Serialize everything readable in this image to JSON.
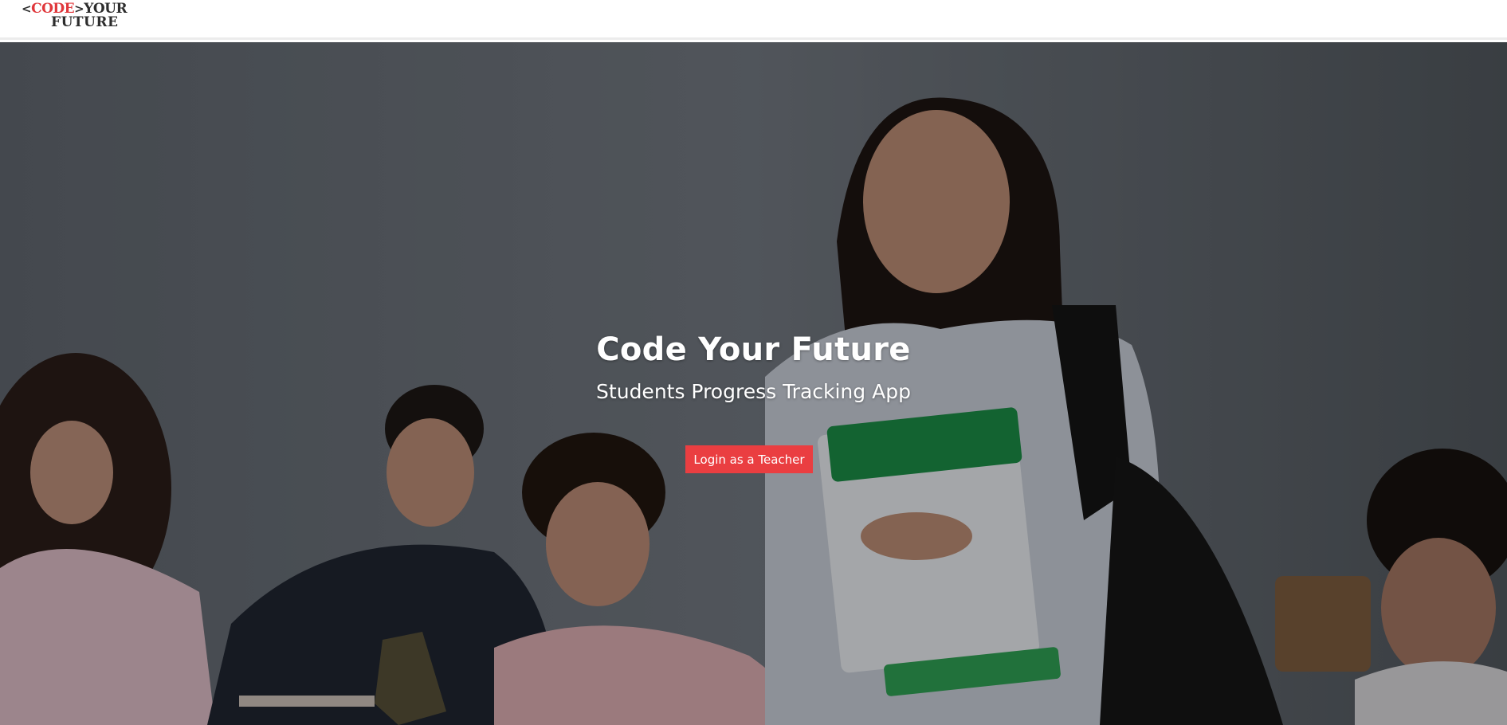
{
  "header": {
    "logo": {
      "open_bracket": "<",
      "code": "CODE",
      "close_bracket": ">",
      "your": "YOUR",
      "future": "FUTURE"
    }
  },
  "hero": {
    "title": "Code Your Future",
    "subtitle": "Students Progress Tracking App",
    "login_button": "Login as a Teacher"
  },
  "colors": {
    "brand_red": "#ea3e41",
    "logo_red": "#e0373b",
    "logo_dark": "#2d2d2d",
    "header_bg": "#ffffff",
    "hero_text": "#ffffff"
  },
  "images": {
    "hero_background": "classroom-students-photo"
  }
}
